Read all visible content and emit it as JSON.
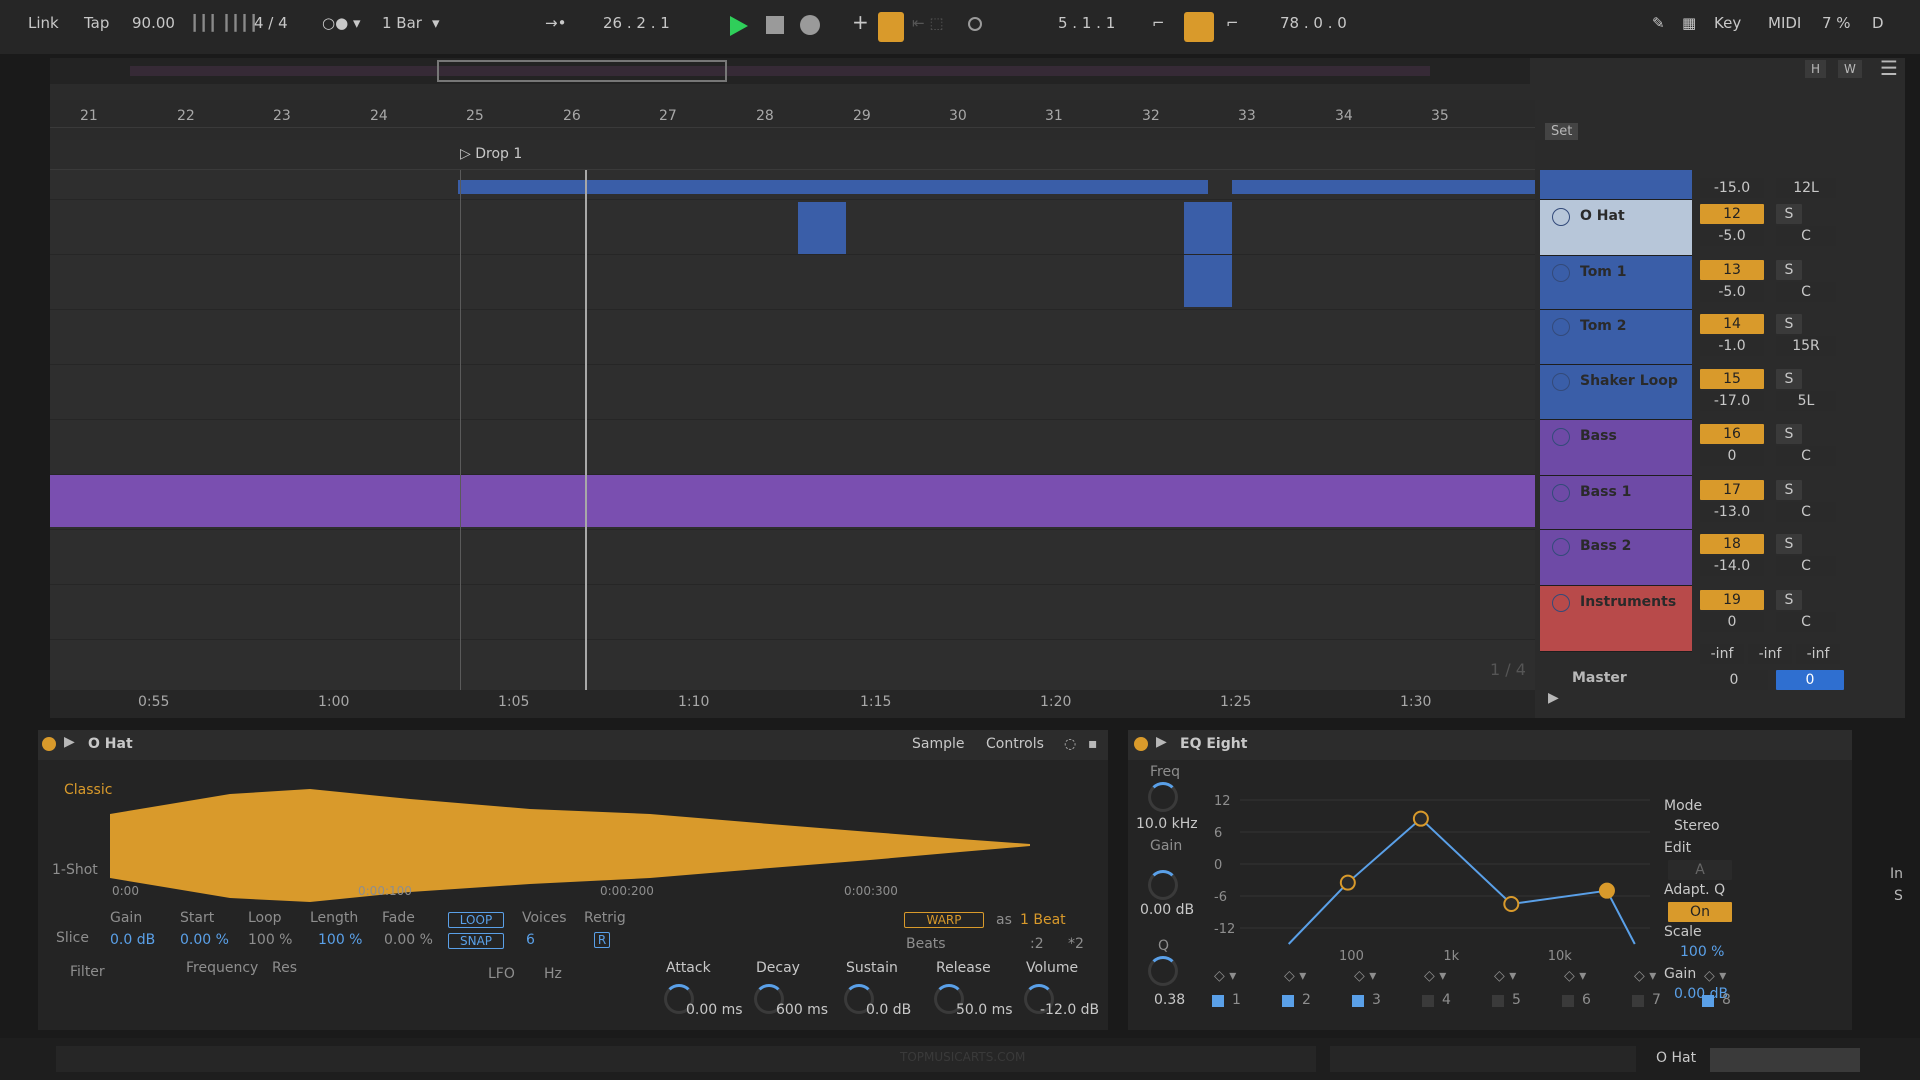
{
  "transport": {
    "link": "Link",
    "tap": "Tap",
    "tempo": "90.00",
    "signature": "4 / 4",
    "quantize": "1 Bar",
    "position": "26 .  2 .  1",
    "loop_start": "5 .  1 .  1",
    "loop_length": "78 .  0 .  0",
    "key": "Key",
    "midi": "MIDI",
    "cpu": "7 %",
    "d": "D"
  },
  "overview_buttons": {
    "h": "H",
    "w": "W"
  },
  "ruler": {
    "bars": [
      "21",
      "22",
      "23",
      "24",
      "25",
      "26",
      "27",
      "28",
      "29",
      "30",
      "31",
      "32",
      "33",
      "34",
      "35"
    ]
  },
  "locator": {
    "name": "Drop 1"
  },
  "timeline": {
    "times": [
      "0:55",
      "1:00",
      "1:05",
      "1:10",
      "1:15",
      "1:20",
      "1:25",
      "1:30"
    ]
  },
  "set_label": "Set",
  "pager": "1 / 4",
  "tracks": [
    {
      "name": "",
      "num": "",
      "vol": "-15.0",
      "pan": "12L",
      "s": "",
      "color": "#3a5ea8"
    },
    {
      "name": "O Hat",
      "num": "12",
      "vol": "-5.0",
      "pan": "C",
      "s": "S",
      "color": "#b7c6d9"
    },
    {
      "name": "Tom 1",
      "num": "13",
      "vol": "-5.0",
      "pan": "C",
      "s": "S",
      "color": "#3a5ea8"
    },
    {
      "name": "Tom 2",
      "num": "14",
      "vol": "-1.0",
      "pan": "15R",
      "s": "S",
      "color": "#3a5ea8"
    },
    {
      "name": "Shaker Loop",
      "num": "15",
      "vol": "-17.0",
      "pan": "5L",
      "s": "S",
      "color": "#3a5ea8"
    },
    {
      "name": "Bass",
      "num": "16",
      "vol": "0",
      "pan": "C",
      "s": "S",
      "color": "#6e4aa6"
    },
    {
      "name": "Bass 1",
      "num": "17",
      "vol": "-13.0",
      "pan": "C",
      "s": "S",
      "color": "#6e4aa6"
    },
    {
      "name": "Bass 2",
      "num": "18",
      "vol": "-14.0",
      "pan": "C",
      "s": "S",
      "color": "#6e4aa6"
    },
    {
      "name": "Instruments",
      "num": "19",
      "vol": "0",
      "pan": "C",
      "s": "S",
      "color": "#b84a4a"
    }
  ],
  "inf": [
    "-inf",
    "-inf",
    "-inf"
  ],
  "master": {
    "name": "Master",
    "vol": "0",
    "pan": "0"
  },
  "simpler": {
    "title": "O Hat",
    "tabs": [
      "Sample",
      "Controls"
    ],
    "modes": [
      "Classic",
      "1-Shot",
      "Slice"
    ],
    "times": [
      "0:00",
      "0:00:100",
      "0:00:200",
      "0:00:300"
    ],
    "params": {
      "gain_l": "Gain",
      "gain": "0.0 dB",
      "start_l": "Start",
      "start": "0.00 %",
      "loop_l": "Loop",
      "loop": "100 %",
      "length_l": "Length",
      "length": "100 %",
      "fade_l": "Fade",
      "fade": "0.00 %",
      "loop_btn": "LOOP",
      "snap_btn": "SNAP",
      "voices_l": "Voices",
      "voices": "6",
      "retrig_l": "Retrig",
      "retrig": "R",
      "warp": "WARP",
      "as": "as",
      "beat": "1 Beat",
      "beats": "Beats",
      "half": ":2",
      "double": "*2"
    },
    "bottom": {
      "filter": "Filter",
      "frequency": "Frequency",
      "res": "Res",
      "lfo": "LFO",
      "hz": "Hz",
      "attack_l": "Attack",
      "attack": "0.00 ms",
      "decay_l": "Decay",
      "decay": "600 ms",
      "sustain_l": "Sustain",
      "sustain": "0.0 dB",
      "release_l": "Release",
      "release": "50.0 ms",
      "volume_l": "Volume",
      "volume": "-12.0 dB"
    }
  },
  "eq": {
    "title": "EQ Eight",
    "freq_l": "Freq",
    "freq": "10.0 kHz",
    "gain_l": "Gain",
    "gain": "0.00 dB",
    "q_l": "Q",
    "q": "0.38",
    "db": [
      "12",
      "6",
      "0",
      "-6",
      "-12"
    ],
    "hz": [
      "100",
      "1k",
      "10k"
    ],
    "mode_l": "Mode",
    "mode": "Stereo",
    "edit_l": "Edit",
    "edit": "A",
    "adapt_l": "Adapt. Q",
    "adapt": "On",
    "scale_l": "Scale",
    "scale": "100 %",
    "outgain_l": "Gain",
    "outgain": "0.00 dB",
    "bands": [
      "1",
      "2",
      "3",
      "4",
      "5",
      "6",
      "7",
      "8"
    ],
    "points": [
      [
        0.62,
        -3.5
      ],
      [
        1.04,
        8.5
      ],
      [
        1.56,
        -7.5
      ],
      [
        2.11,
        -5.0
      ]
    ]
  },
  "side": {
    "in": "In",
    "s": "S"
  },
  "status": {
    "track": "O Hat",
    "watermark": "TOPMUSICARTS.COM"
  }
}
